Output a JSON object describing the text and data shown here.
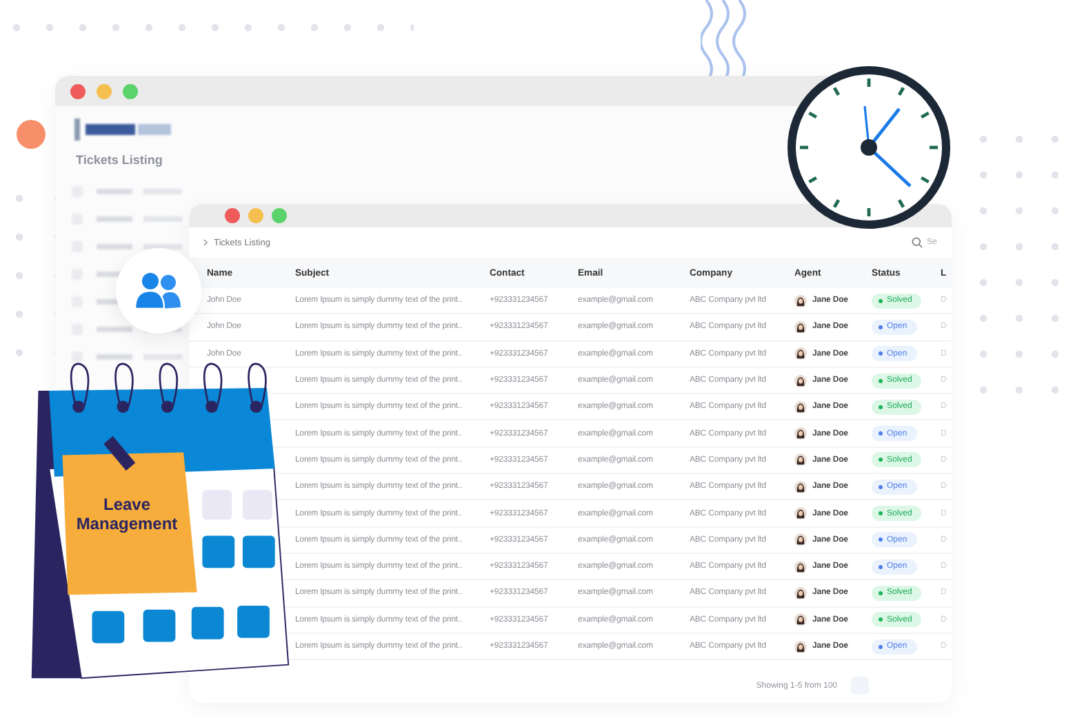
{
  "back_window": {
    "title": "Tickets Listing"
  },
  "window": {
    "breadcrumb": "Tickets Listing",
    "search": {
      "placeholder": "Se"
    }
  },
  "table": {
    "columns": [
      "Name",
      "Subject",
      "Contact",
      "Email",
      "Company",
      "Agent",
      "Status",
      "L"
    ],
    "rows": [
      {
        "name": "John Doe",
        "subject": "Lorem Ipsum is simply dummy text of the print..",
        "contact": "+923331234567",
        "email": "example@gmail.com",
        "company": "ABC Company pvt ltd",
        "agent": "Jane Doe",
        "status": {
          "label": "Solved",
          "kind": "solved"
        },
        "column_8": "D"
      },
      {
        "name": "John Doe",
        "subject": "Lorem Ipsum is simply dummy text of the print..",
        "contact": "+923331234567",
        "email": "example@gmail.com",
        "company": "ABC Company pvt ltd",
        "agent": "Jane Doe",
        "status": {
          "label": "Open",
          "kind": "open"
        },
        "column_8": "D"
      },
      {
        "name": "John Doe",
        "subject": "Lorem Ipsum is simply dummy text of the print..",
        "contact": "+923331234567",
        "email": "example@gmail.com",
        "company": "ABC Company pvt ltd",
        "agent": "Jane Doe",
        "status": {
          "label": "Open",
          "kind": "open"
        },
        "column_8": "D"
      },
      {
        "subject": "Lorem Ipsum is simply dummy text of the print..",
        "contact": "+923331234567",
        "email": "example@gmail.com",
        "company": "ABC Company pvt ltd",
        "agent": "Jane Doe",
        "status": {
          "label": "Solved",
          "kind": "solved"
        },
        "column_8": "D"
      },
      {
        "subject": "Lorem Ipsum is simply dummy text of the print..",
        "contact": "+923331234567",
        "email": "example@gmail.com",
        "company": "ABC Company pvt ltd",
        "agent": "Jane Doe",
        "status": {
          "label": "Solved",
          "kind": "solved"
        },
        "column_8": "D"
      },
      {
        "subject": "Lorem Ipsum is simply dummy text of the print..",
        "contact": "+923331234567",
        "email": "example@gmail.com",
        "company": "ABC Company pvt ltd",
        "agent": "Jane Doe",
        "status": {
          "label": "Open",
          "kind": "open"
        },
        "column_8": "D"
      },
      {
        "subject": "Lorem Ipsum is simply dummy text of the print..",
        "contact": "+923331234567",
        "email": "example@gmail.com",
        "company": "ABC Company pvt ltd",
        "agent": "Jane Doe",
        "status": {
          "label": "Solved",
          "kind": "solved"
        },
        "column_8": "D"
      },
      {
        "subject": "Lorem Ipsum is simply dummy text of the print..",
        "contact": "+923331234567",
        "email": "example@gmail.com",
        "company": "ABC Company pvt ltd",
        "agent": "Jane Doe",
        "status": {
          "label": "Open",
          "kind": "open"
        },
        "column_8": "D"
      },
      {
        "subject": "Lorem Ipsum is simply dummy text of the print..",
        "contact": "+923331234567",
        "email": "example@gmail.com",
        "company": "ABC Company pvt ltd",
        "agent": "Jane Doe",
        "status": {
          "label": "Solved",
          "kind": "solved"
        },
        "column_8": "D"
      },
      {
        "subject": "Lorem Ipsum is simply dummy text of the print..",
        "contact": "+923331234567",
        "email": "example@gmail.com",
        "company": "ABC Company pvt ltd",
        "agent": "Jane Doe",
        "status": {
          "label": "Open",
          "kind": "open"
        },
        "column_8": "D"
      },
      {
        "subject": "Lorem Ipsum is simply dummy text of the print..",
        "contact": "+923331234567",
        "email": "example@gmail.com",
        "company": "ABC Company pvt ltd",
        "agent": "Jane Doe",
        "status": {
          "label": "Open",
          "kind": "open"
        },
        "column_8": "D"
      },
      {
        "subject": "Lorem Ipsum is simply dummy text of the print..",
        "contact": "+923331234567",
        "email": "example@gmail.com",
        "company": "ABC Company pvt ltd",
        "agent": "Jane Doe",
        "status": {
          "label": "Solved",
          "kind": "solved"
        },
        "column_8": "D"
      },
      {
        "subject": "Lorem Ipsum is simply dummy text of the print..",
        "contact": "+923331234567",
        "email": "example@gmail.com",
        "company": "ABC Company pvt ltd",
        "agent": "Jane Doe",
        "status": {
          "label": "Solved",
          "kind": "solved"
        },
        "column_8": "D"
      },
      {
        "subject": "Lorem Ipsum is simply dummy text of the print..",
        "contact": "+923331234567",
        "email": "example@gmail.com",
        "company": "ABC Company pvt ltd",
        "agent": "Jane Doe",
        "status": {
          "label": "Open",
          "kind": "open"
        },
        "column_8": "D"
      }
    ]
  },
  "footer": {
    "pagination": "Showing 1-5 from 100"
  },
  "calendar": {
    "title": "Leave Management"
  }
}
